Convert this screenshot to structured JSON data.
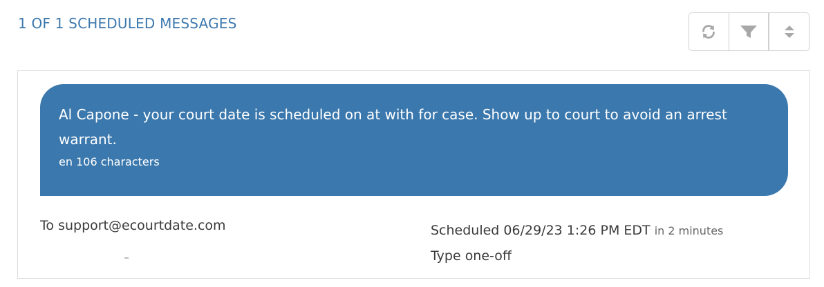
{
  "header": {
    "title": "1 OF 1 SCHEDULED MESSAGES"
  },
  "toolbar": {
    "buttons": [
      {
        "name": "refresh",
        "icon": "refresh-icon"
      },
      {
        "name": "filter",
        "icon": "filter-icon"
      },
      {
        "name": "sort",
        "icon": "sort-icon"
      }
    ]
  },
  "message": {
    "text": "Al Capone - your court date is scheduled on at with for case. Show up to court to avoid an arrest warrant.",
    "language": "en",
    "characters": "106 characters",
    "to_label": "To",
    "to_value": "support@ecourtdate.com",
    "scheduled_label": "Scheduled",
    "scheduled_value": "06/29/23 1:26 PM EDT",
    "scheduled_relative": "in 2 minutes",
    "type_label": "Type",
    "type_value": "one-off"
  },
  "colors": {
    "accent": "#3b78ad",
    "title": "#3c78ad",
    "icon": "#a8a8a8"
  }
}
